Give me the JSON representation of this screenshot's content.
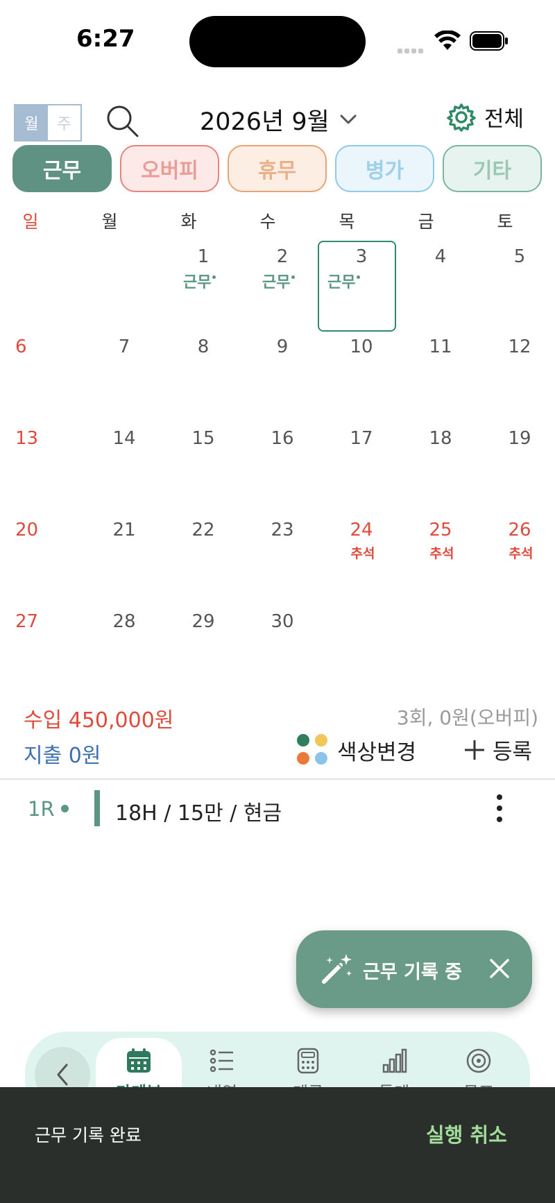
{
  "status_bar": {
    "time": "6:27"
  },
  "header": {
    "view_toggle": {
      "month": "월",
      "week": "주"
    },
    "month_title": "2026년 9월",
    "settings_label": "전체"
  },
  "chips": [
    {
      "label": "근무",
      "bg": "#5f9282",
      "border": "#5f9282",
      "color": "#ffffff"
    },
    {
      "label": "오버피",
      "bg": "#fde9e8",
      "border": "#e8837c",
      "color": "#e89d97"
    },
    {
      "label": "휴무",
      "bg": "#fdeee4",
      "border": "#e9a274",
      "color": "#e9b08a"
    },
    {
      "label": "병가",
      "bg": "#eaf5fc",
      "border": "#8ec9ea",
      "color": "#9fd0ea"
    },
    {
      "label": "기타",
      "bg": "#e7f3ee",
      "border": "#7ab69e",
      "color": "#9cc7b4"
    }
  ],
  "weekdays": [
    "일",
    "월",
    "화",
    "수",
    "목",
    "금",
    "토"
  ],
  "calendar": {
    "work_badge": "근무",
    "holiday_label": "추석",
    "weeks": [
      [
        "",
        "",
        "1",
        "2",
        "3",
        "4",
        "5"
      ],
      [
        "6",
        "7",
        "8",
        "9",
        "10",
        "11",
        "12"
      ],
      [
        "13",
        "14",
        "15",
        "16",
        "17",
        "18",
        "19"
      ],
      [
        "20",
        "21",
        "22",
        "23",
        "24",
        "25",
        "26"
      ],
      [
        "27",
        "28",
        "29",
        "30",
        "",
        "",
        ""
      ]
    ]
  },
  "summary": {
    "income": "수입 450,000원",
    "expense": "지출 0원",
    "count": "3회, 0원(오버피)",
    "color_change": "색상변경",
    "register": "등록"
  },
  "record": {
    "round": "1R",
    "details": "18H / 15만 / 현금"
  },
  "fab": {
    "label": "근무 기록 중"
  },
  "tabbar": {
    "items": [
      {
        "label": "가계부",
        "icon": "calendar-icon"
      },
      {
        "label": "내역",
        "icon": "list-icon"
      },
      {
        "label": "계급",
        "icon": "calculator-icon"
      },
      {
        "label": "통계",
        "icon": "bar-chart-icon"
      },
      {
        "label": "목표",
        "icon": "target-icon"
      }
    ]
  },
  "snackbar": {
    "message": "근무 기록 완료",
    "action": "실행 취소"
  },
  "colors": {
    "accent": "#5a9682",
    "weekend_red": "#e04a3c",
    "expense_blue": "#3f6fb3"
  }
}
